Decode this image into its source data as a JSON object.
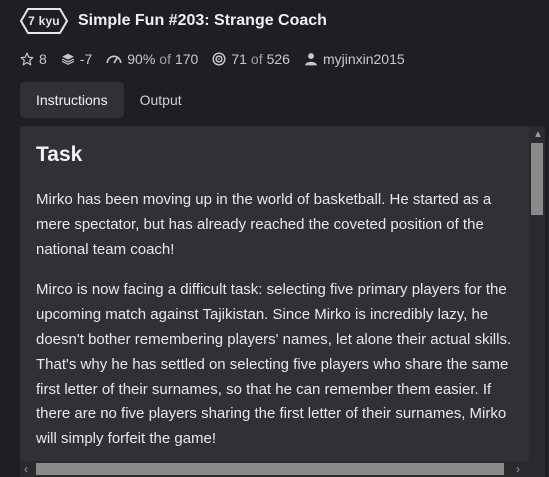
{
  "kata": {
    "rank": "7 kyu",
    "title": "Simple Fun #203: Strange Coach"
  },
  "stats": {
    "stars": "8",
    "votes": "-7",
    "satisfaction": "90%",
    "satisfaction_of": "of",
    "satisfaction_total": "170",
    "completions": "71",
    "completions_of": "of",
    "completions_total": "526",
    "author": "myjinxin2015"
  },
  "tabs": [
    {
      "label": "Instructions",
      "active": true
    },
    {
      "label": "Output",
      "active": false
    }
  ],
  "description": {
    "heading": "Task",
    "paragraphs": [
      "Mirko has been moving up in the world of basketball. He started as a mere spectator, but has already reached the coveted position of the national team coach!",
      "Mirco is now facing a difficult task: selecting five primary players for the upcoming match against Tajikistan. Since Mirko is incredibly lazy, he doesn't bother remembering players' names, let alone their actual skills. That's why he has settled on selecting five players who share the same first letter of their surnames, so that he can remember them easier. If there are no five players sharing the first letter of their surnames, Mirko will simply forfeit the game!"
    ]
  },
  "icons": {
    "star": "star-icon",
    "votes": "stack-icon",
    "satisfaction": "gauge-icon",
    "completions": "target-icon",
    "author": "user-icon"
  },
  "colors": {
    "background": "#1f1f23",
    "panel": "#303036",
    "text": "#e8e8e8",
    "muted": "#a0a0a0"
  }
}
